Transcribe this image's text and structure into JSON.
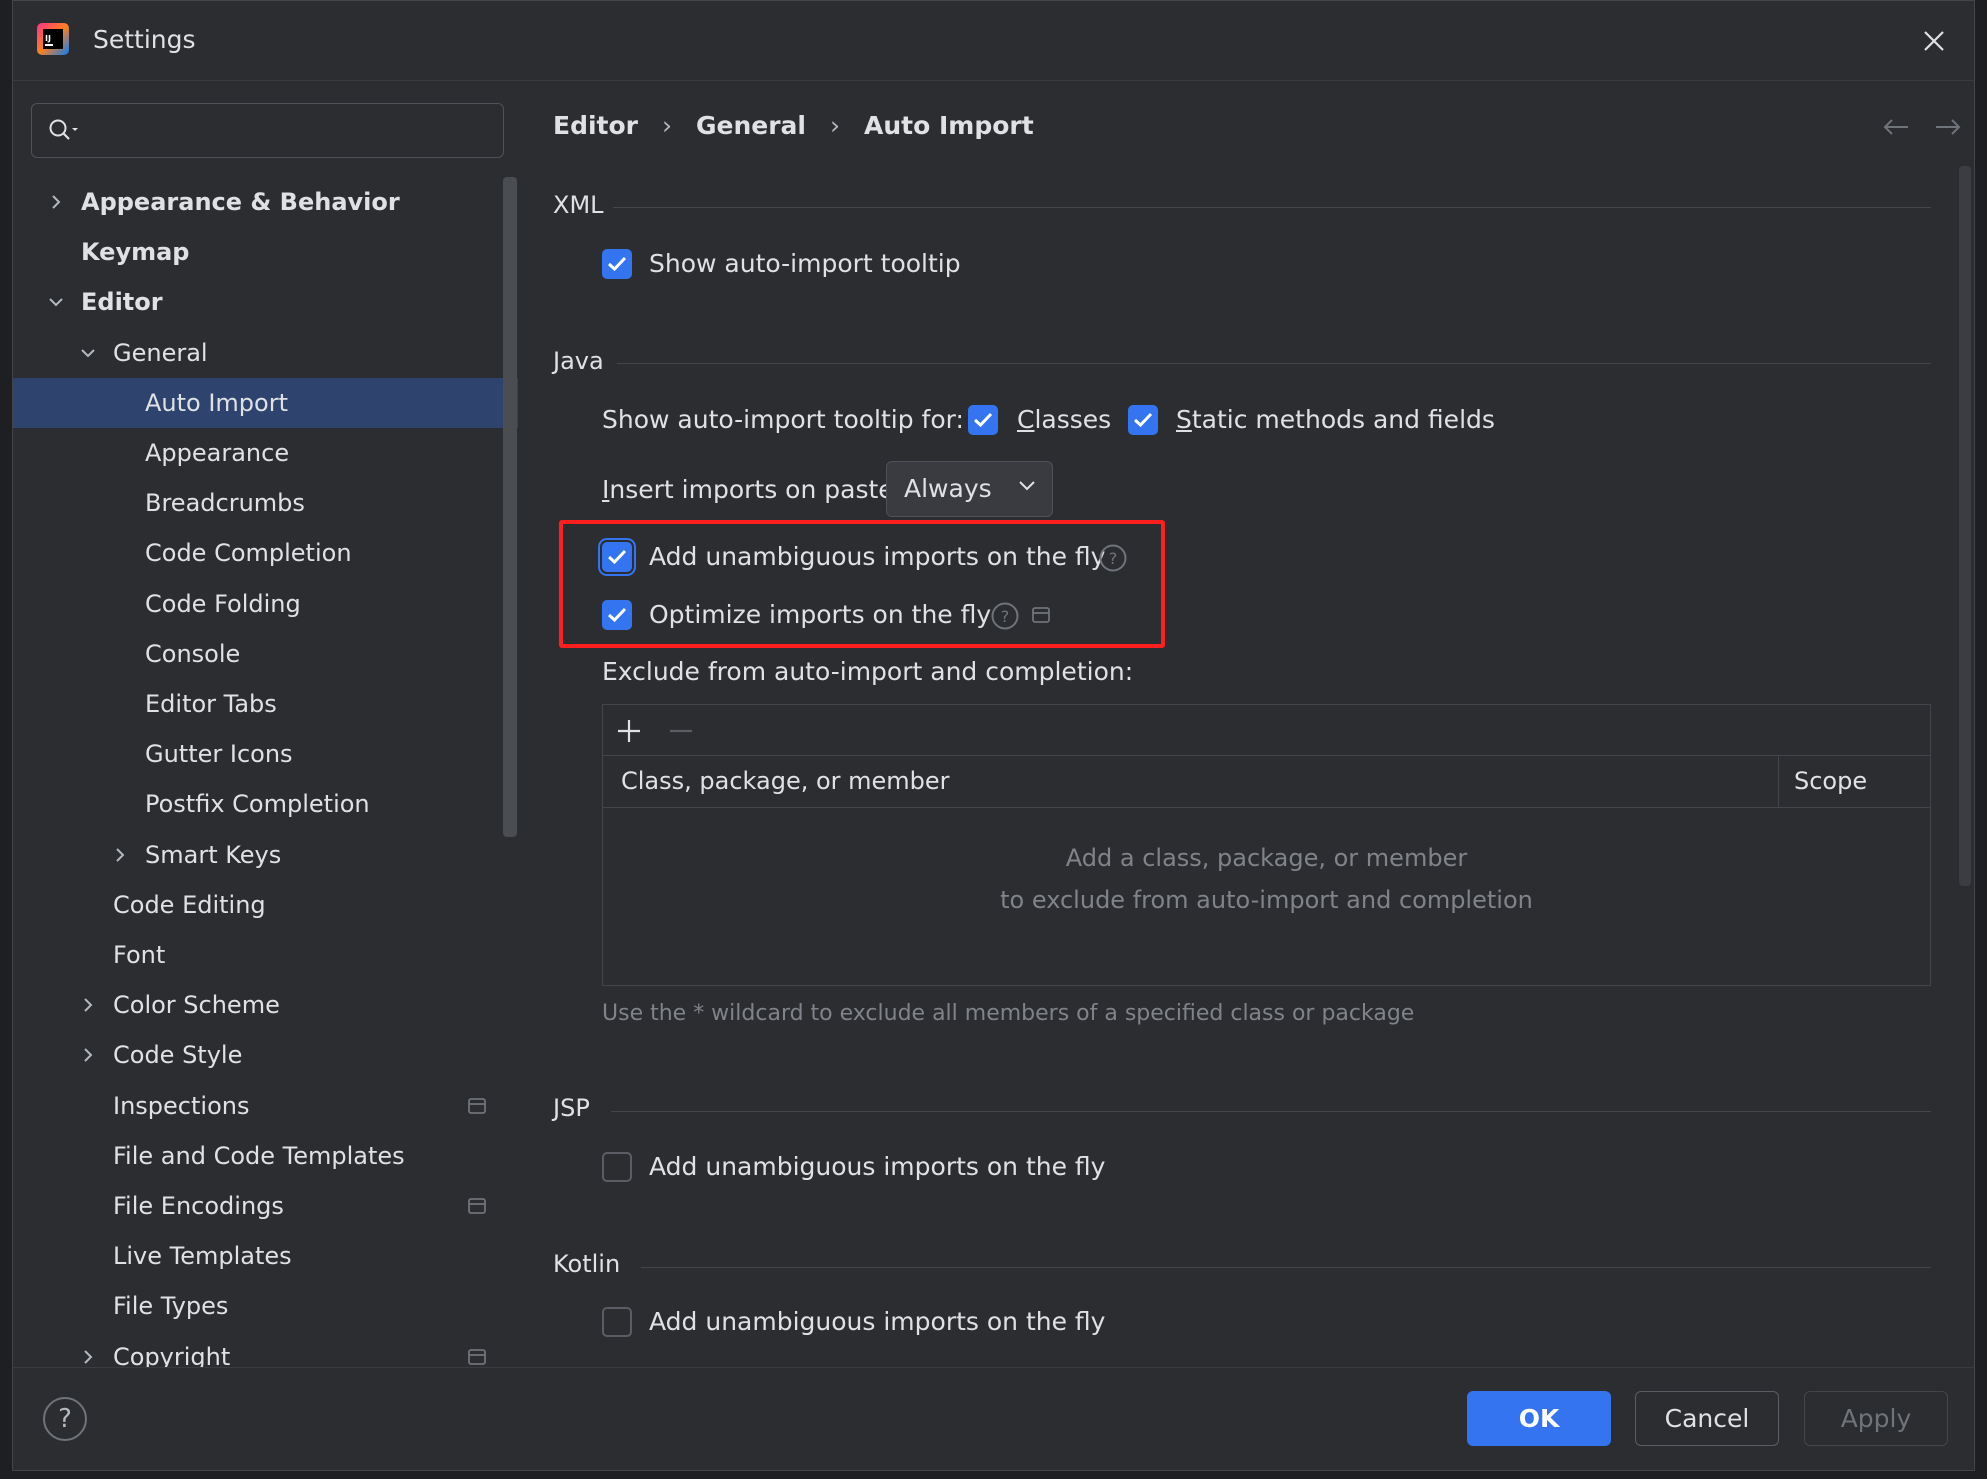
{
  "window": {
    "title": "Settings"
  },
  "search": {
    "placeholder": "",
    "value": ""
  },
  "tree": [
    {
      "label": "Appearance & Behavior",
      "level": 0,
      "chevron": "right",
      "bold": true
    },
    {
      "label": "Keymap",
      "level": 0,
      "chevron": "none",
      "bold": true
    },
    {
      "label": "Editor",
      "level": 0,
      "chevron": "down",
      "bold": true
    },
    {
      "label": "General",
      "level": 1,
      "chevron": "down"
    },
    {
      "label": "Auto Import",
      "level": 2,
      "chevron": "none",
      "selected": true
    },
    {
      "label": "Appearance",
      "level": 2,
      "chevron": "none"
    },
    {
      "label": "Breadcrumbs",
      "level": 2,
      "chevron": "none"
    },
    {
      "label": "Code Completion",
      "level": 2,
      "chevron": "none"
    },
    {
      "label": "Code Folding",
      "level": 2,
      "chevron": "none"
    },
    {
      "label": "Console",
      "level": 2,
      "chevron": "none"
    },
    {
      "label": "Editor Tabs",
      "level": 2,
      "chevron": "none"
    },
    {
      "label": "Gutter Icons",
      "level": 2,
      "chevron": "none"
    },
    {
      "label": "Postfix Completion",
      "level": 2,
      "chevron": "none"
    },
    {
      "label": "Smart Keys",
      "level": 2,
      "chevron": "right"
    },
    {
      "label": "Code Editing",
      "level": 1,
      "chevron": "none"
    },
    {
      "label": "Font",
      "level": 1,
      "chevron": "none"
    },
    {
      "label": "Color Scheme",
      "level": 1,
      "chevron": "right"
    },
    {
      "label": "Code Style",
      "level": 1,
      "chevron": "right"
    },
    {
      "label": "Inspections",
      "level": 1,
      "chevron": "none",
      "project_icon": true
    },
    {
      "label": "File and Code Templates",
      "level": 1,
      "chevron": "none"
    },
    {
      "label": "File Encodings",
      "level": 1,
      "chevron": "none",
      "project_icon": true
    },
    {
      "label": "Live Templates",
      "level": 1,
      "chevron": "none"
    },
    {
      "label": "File Types",
      "level": 1,
      "chevron": "none"
    },
    {
      "label": "Copyright",
      "level": 1,
      "chevron": "right",
      "project_icon": true
    }
  ],
  "breadcrumb": {
    "items": [
      "Editor",
      "General",
      "Auto Import"
    ],
    "separator": "›"
  },
  "xml": {
    "title": "XML",
    "show_tooltip_label": "Show auto-import tooltip",
    "show_tooltip_checked": true
  },
  "java": {
    "title": "Java",
    "tooltip_for_label": "Show auto-import tooltip for:",
    "classes_label": "Classes",
    "classes_checked": true,
    "static_label": "Static methods and fields",
    "static_checked": true,
    "insert_label": "Insert imports on paste:",
    "insert_value": "Always",
    "add_unambiguous_label": "Add unambiguous imports on the fly",
    "add_unambiguous_checked": true,
    "optimize_label": "Optimize imports on the fly",
    "optimize_checked": true,
    "exclude_label": "Exclude from auto-import and completion:",
    "table": {
      "col_class": "Class, package, or member",
      "col_scope": "Scope",
      "empty_line1": "Add a class, package, or member",
      "empty_line2": "to exclude from auto-import and completion"
    },
    "hint": "Use the * wildcard to exclude all members of a specified class or package"
  },
  "jsp": {
    "title": "JSP",
    "add_unambiguous_label": "Add unambiguous imports on the fly",
    "add_unambiguous_checked": false
  },
  "kotlin": {
    "title": "Kotlin",
    "add_unambiguous_label": "Add unambiguous imports on the fly",
    "add_unambiguous_checked": false
  },
  "buttons": {
    "ok": "OK",
    "cancel": "Cancel",
    "apply": "Apply",
    "help": "?"
  },
  "colors": {
    "accent": "#3574f0",
    "highlight": "#ff1f1f",
    "selection": "#2e436e",
    "background": "#2b2d30"
  }
}
